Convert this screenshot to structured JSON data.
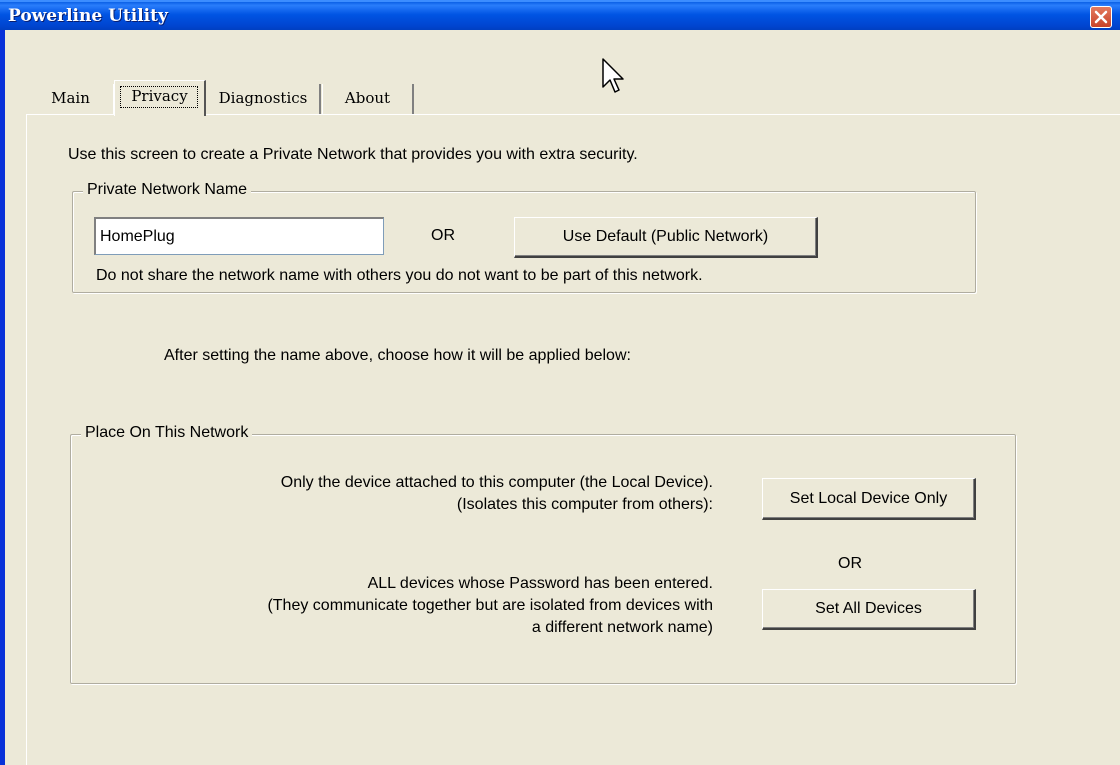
{
  "window": {
    "title": "Powerline Utility"
  },
  "tabs": [
    {
      "label": "Main"
    },
    {
      "label": "Privacy"
    },
    {
      "label": "Diagnostics"
    },
    {
      "label": "About"
    }
  ],
  "privacy": {
    "intro": "Use this screen to create a Private Network that provides you with extra security.",
    "private_network_group": {
      "legend": "Private Network Name",
      "name_value": "HomePlug",
      "or_label": "OR",
      "default_button": "Use Default (Public Network)",
      "note": "Do not share the network name with others you do not want to be part of this network."
    },
    "apply_instruction": "After setting the name above, choose how it will be applied below:",
    "place_group": {
      "legend": "Place On This Network",
      "local_line1": "Only the device attached to this computer (the Local Device).",
      "local_line2": "(Isolates this computer from others):",
      "local_button": "Set Local Device Only",
      "or_label": "OR",
      "all_line1": "ALL devices whose Password has been entered.",
      "all_line2": "(They communicate together but are isolated from devices with",
      "all_line3": "a different network name)",
      "all_button": "Set All Devices"
    }
  }
}
